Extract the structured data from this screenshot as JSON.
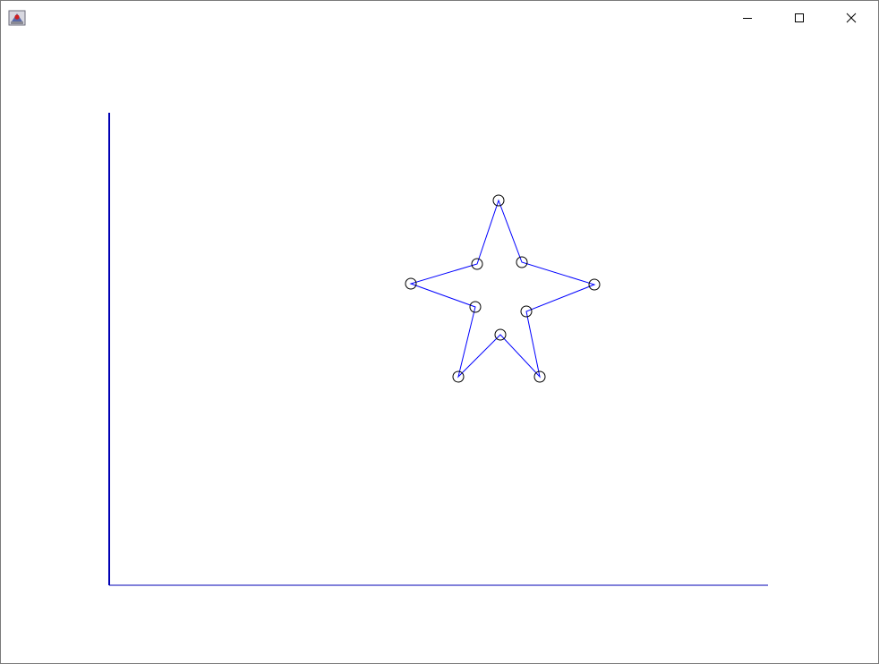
{
  "window": {
    "title": "",
    "icon": "java-app-icon",
    "controls": {
      "minimize_icon": "minimize-icon",
      "maximize_icon": "maximize-icon",
      "close_icon": "close-icon"
    }
  },
  "plot": {
    "axis_color": "#0000b4",
    "line_color": "#0000ff",
    "marker_color": "#000000",
    "marker": "hollow-circle",
    "shape": "star",
    "x_range": [
      0,
      736
    ],
    "y_range": [
      0,
      528
    ],
    "points": [
      {
        "x": 435,
        "y": 430
      },
      {
        "x": 461,
        "y": 361
      },
      {
        "x": 542,
        "y": 336
      },
      {
        "x": 466,
        "y": 306
      },
      {
        "x": 481,
        "y": 233
      },
      {
        "x": 437,
        "y": 280
      },
      {
        "x": 390,
        "y": 233
      },
      {
        "x": 409,
        "y": 311
      },
      {
        "x": 337,
        "y": 337
      },
      {
        "x": 411,
        "y": 359
      }
    ]
  }
}
